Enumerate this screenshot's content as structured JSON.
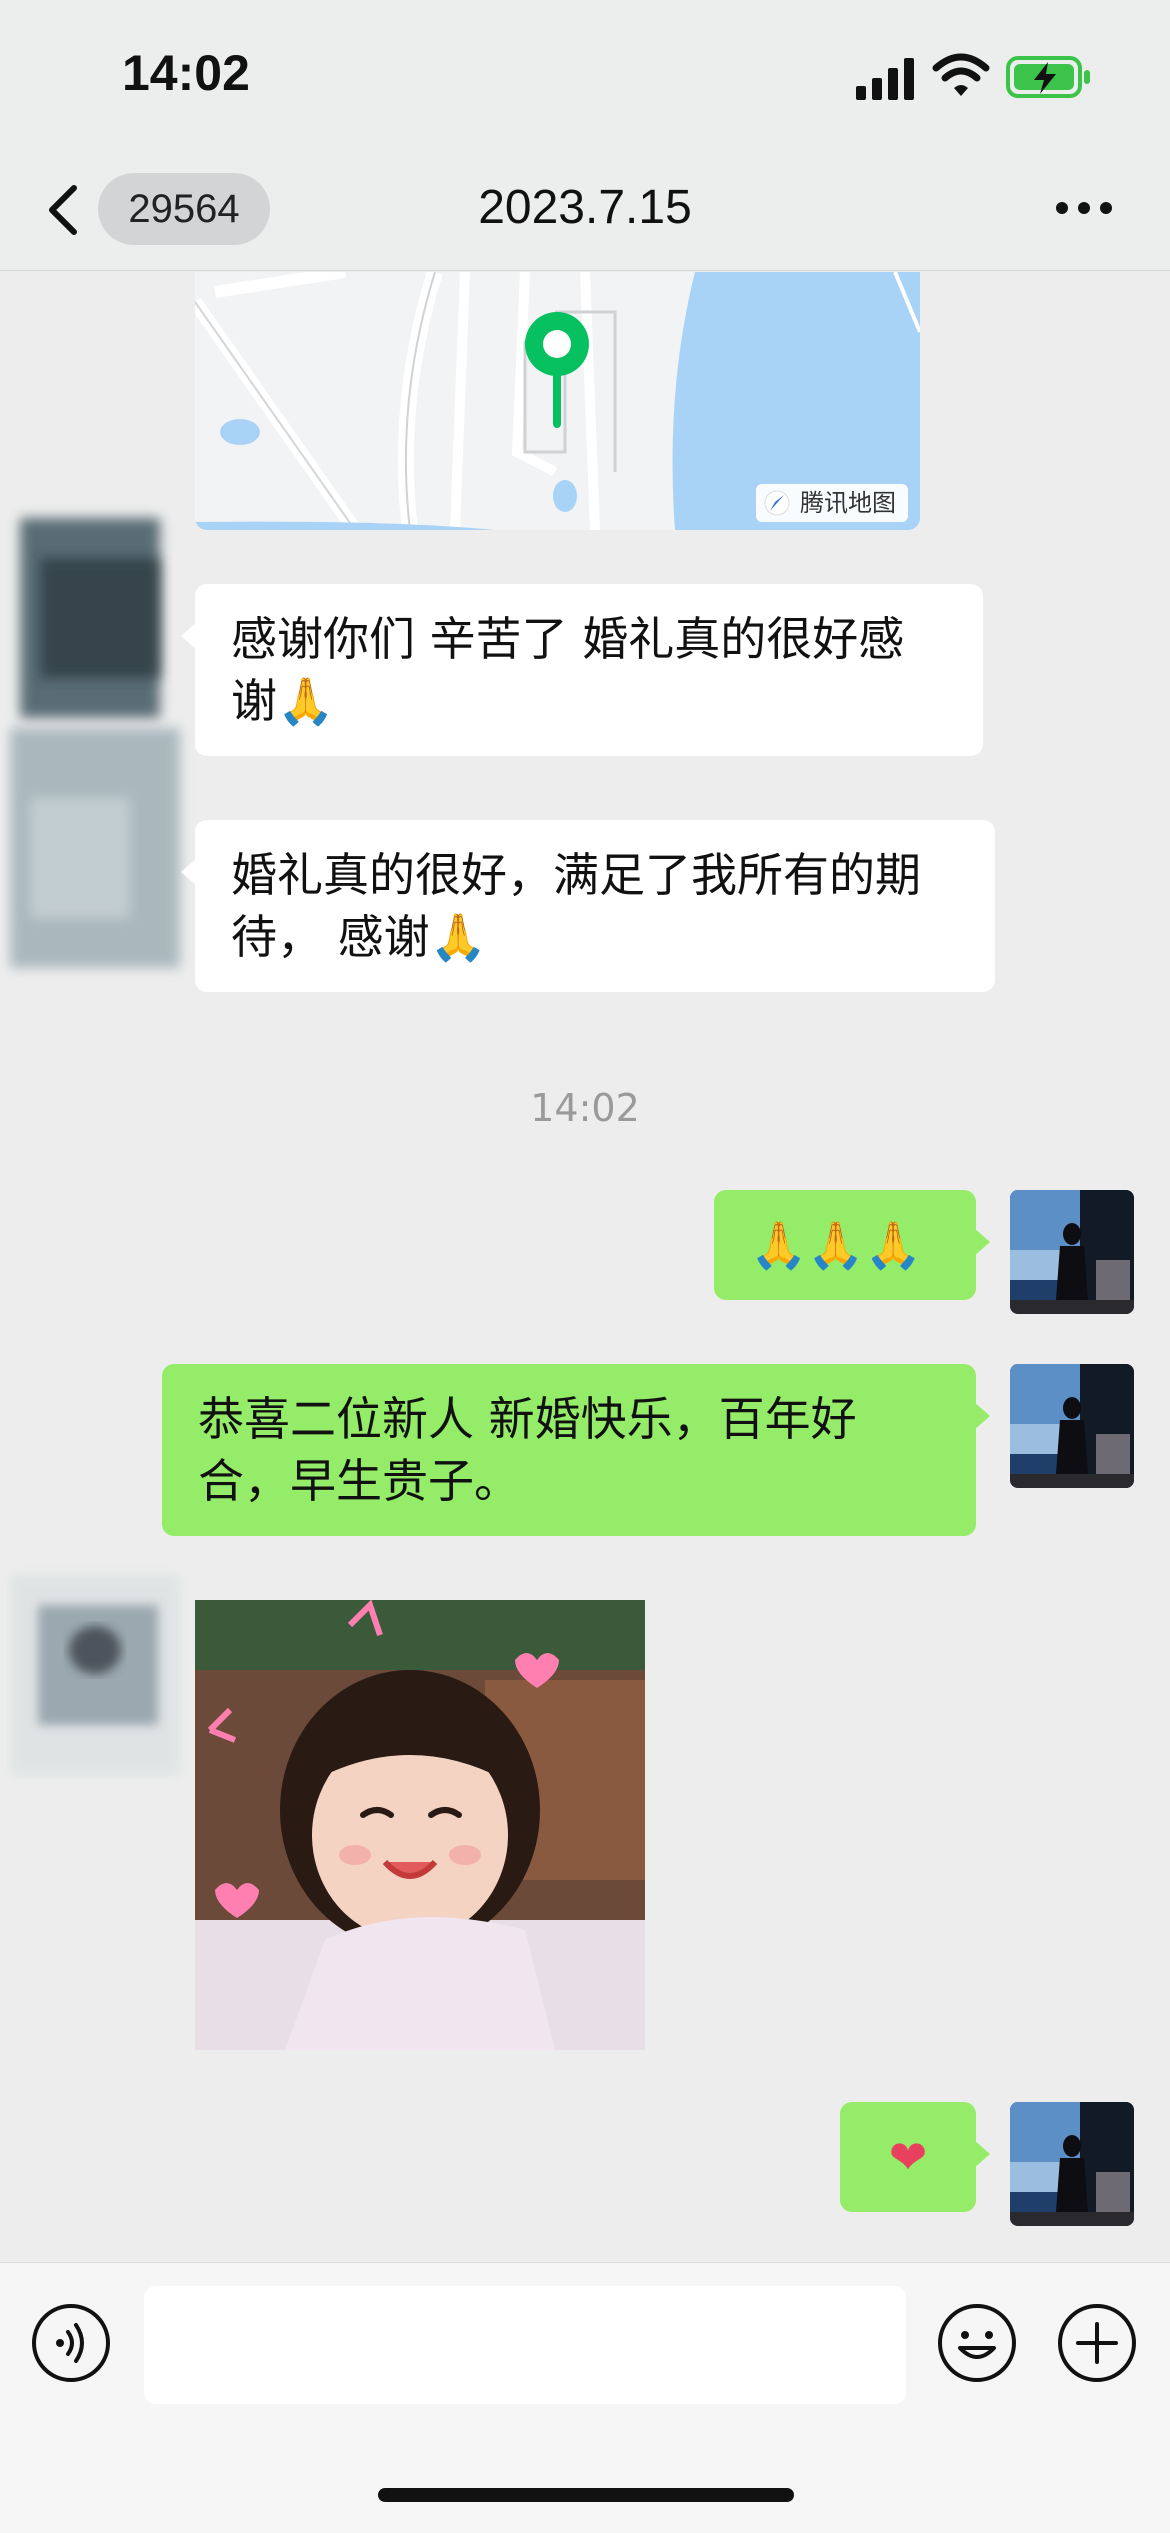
{
  "status_bar": {
    "time": "14:02"
  },
  "nav": {
    "unread_count": "29564",
    "title": "2023.7.15"
  },
  "map": {
    "attribution": "腾讯地图"
  },
  "messages": [
    {
      "side": "left",
      "text": "感谢你们 辛苦了 婚礼真的很好感谢🙏"
    },
    {
      "side": "left",
      "text": "婚礼真的很好，满足了我所有的期待， 感谢🙏"
    },
    {
      "side": "right",
      "text": "🙏🙏🙏"
    },
    {
      "side": "right",
      "text": "恭喜二位新人 新婚快乐，百年好合，早生贵子。"
    },
    {
      "side": "right",
      "text": "❤"
    }
  ],
  "timestamp": "14:02",
  "input": {
    "value": ""
  },
  "colors": {
    "bubble_sent": "#95ec69",
    "bubble_received": "#ffffff",
    "background": "#ededed"
  }
}
